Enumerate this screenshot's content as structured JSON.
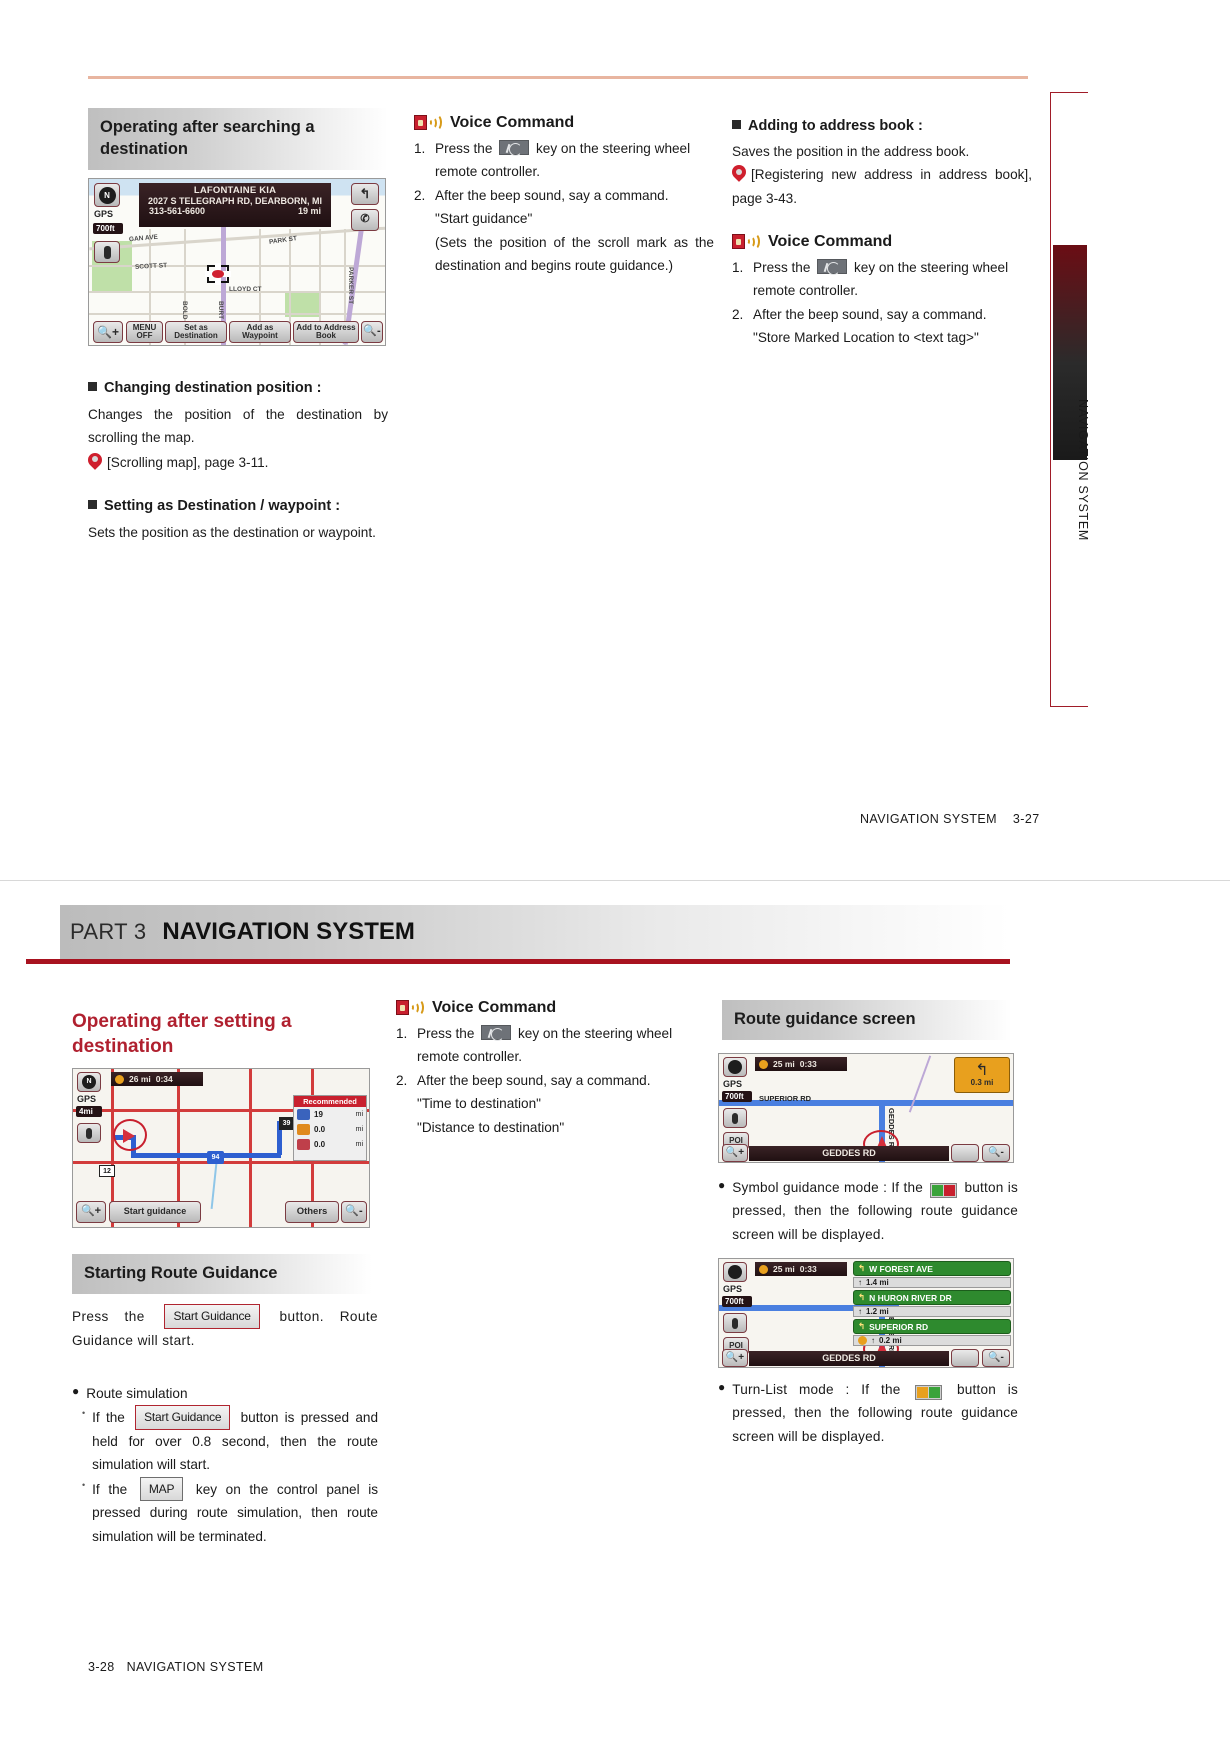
{
  "page1": {
    "section_heading": "Operating after searching a destination",
    "screenshot": {
      "title": "LAFONTAINE KIA",
      "address": "2027 S TELEGRAPH RD, DEARBORN, MI",
      "phone": "313-561-6600",
      "distance": "19 mi",
      "gps_label": "GPS",
      "scale": "700ft",
      "buttons": [
        "MENU OFF",
        "Set as Destination",
        "Add as Waypoint",
        "Add to Address Book"
      ],
      "road_labels": [
        "GAN AVE",
        "PARK ST",
        "SCOTT ST",
        "LLOYD CT",
        "BOLD",
        "BURT",
        "PARKER ST"
      ]
    },
    "changing_destination": {
      "heading": "Changing destination position :",
      "body": "Changes the position of the destination by scrolling the map.",
      "reference": "[Scrolling map], page 3-11."
    },
    "setting_as_destination": {
      "heading": "Setting as Destination / waypoint :",
      "body": "Sets the position as the destination or waypoint."
    },
    "voice_command_1": {
      "title": "Voice Command",
      "step1_a": "Press the",
      "step1_b": "key on the steering wheel",
      "step1_c": "remote controller.",
      "step2": "After the beep sound, say a command.",
      "quote1": "\"Start guidance\"",
      "note": "(Sets the position of the scroll mark as the destination and begins route guidance.)"
    },
    "adding_address_book": {
      "heading": "Adding to address book :",
      "body": "Saves the position in the address book.",
      "reference": "[Registering new address in address book], page 3-43."
    },
    "voice_command_2": {
      "title": "Voice Command",
      "step1_a": "Press the",
      "step1_b": "key on the steering wheel",
      "step1_c": "remote controller.",
      "step2": "After the beep sound, say a command.",
      "quote1": "\"Store Marked Location to <text tag>\""
    },
    "side_tab": "NAVIGATION SYSTEM",
    "footer": {
      "label": "NAVIGATION SYSTEM",
      "page": "3-27"
    }
  },
  "page2": {
    "part_label": "PART 3",
    "part_title": "NAVIGATION SYSTEM",
    "section_heading": "Operating after setting a destination",
    "screenshot": {
      "distance": "26 mi",
      "time": "0:34",
      "gps_label": "GPS",
      "scale": "4mi",
      "recommended": "Recommended",
      "route_rows": [
        {
          "value": "19",
          "unit": "mi"
        },
        {
          "value": "0.0",
          "unit": "mi"
        },
        {
          "value": "0.0",
          "unit": "mi"
        }
      ],
      "start_button": "Start guidance",
      "others_button": "Others",
      "shield_12": "12",
      "shield_94": "94",
      "shield_39": "39"
    },
    "voice_command": {
      "title": "Voice Command",
      "step1_a": "Press the",
      "step1_b": "key on the steering wheel",
      "step1_c": "remote controller.",
      "step2": "After the beep sound, say a command.",
      "quote1": "\"Time to destination\"",
      "quote2": "\"Distance to destination\""
    },
    "starting_route_guidance": {
      "heading": "Starting Route Guidance",
      "press_a": "Press the",
      "button_token": "Start Guidance",
      "press_b": "button. Route Guidance will start.",
      "route_simulation_title": "Route simulation",
      "sim_1_a": "If the",
      "sim_1_token": "Start Guidance",
      "sim_1_b": "button is pressed and held for over 0.8  second, then the route simulation will start.",
      "sim_2_a": "If the",
      "sim_2_token": "MAP",
      "sim_2_b": "key on the control panel is pressed during route simulation, then route simulation will be terminated."
    },
    "route_guidance_screen": {
      "heading": "Route guidance screen",
      "screen1": {
        "distance": "25 mi",
        "time": "0:33",
        "gps_label": "GPS",
        "scale": "700ft",
        "poi_label": "POI",
        "turn_distance": "0.3 mi",
        "road_top": "SUPERIOR RD",
        "road_vertical": "GEDDES RD",
        "road_bottom": "GEDDES RD"
      },
      "symbol_mode": {
        "text_a": "Symbol guidance mode : If the",
        "text_b": "button is pressed, then the following route guidance screen will be displayed."
      },
      "screen2": {
        "distance": "25 mi",
        "time": "0:33",
        "gps_label": "GPS",
        "scale": "700ft",
        "poi_label": "POI",
        "road_bottom": "GEDDES RD",
        "road_vertical": "GEDDES RD",
        "turn_list": [
          {
            "name": "W FOREST AVE",
            "dist": "1.4 mi"
          },
          {
            "name": "N HURON RIVER DR",
            "dist": "1.2 mi"
          },
          {
            "name": "SUPERIOR RD",
            "dist": "0.2 mi"
          }
        ]
      },
      "turnlist_mode": {
        "text_a": "Turn-List mode : If the",
        "text_b": "button is pressed, then the following route guidance screen will be displayed."
      }
    },
    "footer": {
      "page": "3-28",
      "label": "NAVIGATION SYSTEM"
    }
  },
  "colors": {
    "accent_red": "#a8121f",
    "heading_red": "#b0202f",
    "grey_head": "#bfbfbf"
  }
}
